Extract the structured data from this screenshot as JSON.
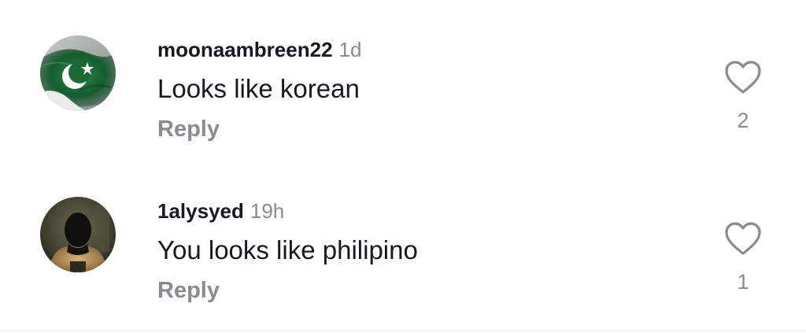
{
  "comments": [
    {
      "username": "moonaambreen22",
      "time": "1d",
      "text": "Looks like korean",
      "reply_label": "Reply",
      "like_count": "2",
      "avatar": "pakistan-flag-avatar"
    },
    {
      "username": "1alysyed",
      "time": "19h",
      "text": "You looks like philipino",
      "reply_label": "Reply",
      "like_count": "1",
      "avatar": "dark-figure-avatar"
    }
  ],
  "icons": {
    "like": "heart-outline-icon"
  },
  "colors": {
    "username": "#161823",
    "secondary": "#8a8b91",
    "flag_green": "#0b5d2a"
  }
}
